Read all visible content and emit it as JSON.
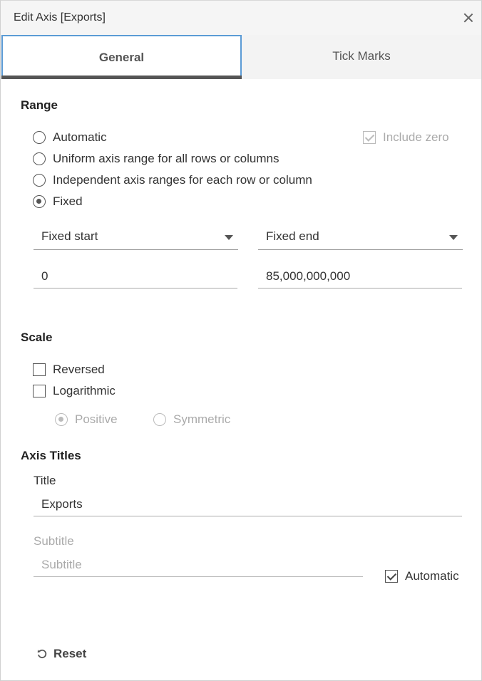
{
  "dialog": {
    "title": "Edit Axis [Exports]"
  },
  "tabs": [
    {
      "label": "General",
      "active": true
    },
    {
      "label": "Tick Marks",
      "active": false
    }
  ],
  "range": {
    "heading": "Range",
    "options": [
      {
        "label": "Automatic",
        "selected": false
      },
      {
        "label": "Uniform axis range for all rows or columns",
        "selected": false
      },
      {
        "label": "Independent axis ranges for each row or column",
        "selected": false
      },
      {
        "label": "Fixed",
        "selected": true
      }
    ],
    "include_zero": {
      "label": "Include zero",
      "checked": true,
      "disabled": true
    },
    "start_dropdown": {
      "value": "Fixed start"
    },
    "end_dropdown": {
      "value": "Fixed end"
    },
    "start_value": "0",
    "end_value": "85,000,000,000"
  },
  "scale": {
    "heading": "Scale",
    "reversed": {
      "label": "Reversed",
      "checked": false
    },
    "logarithmic": {
      "label": "Logarithmic",
      "checked": false
    },
    "log_options": [
      {
        "label": "Positive",
        "selected": true,
        "disabled": true
      },
      {
        "label": "Symmetric",
        "selected": false,
        "disabled": true
      }
    ]
  },
  "axis_titles": {
    "heading": "Axis Titles",
    "title_label": "Title",
    "title_value": "Exports",
    "subtitle_label": "Subtitle",
    "subtitle_placeholder": "Subtitle",
    "automatic": {
      "label": "Automatic",
      "checked": true
    }
  },
  "footer": {
    "reset_label": "Reset"
  },
  "colors": {
    "accent": "#5b9bd5",
    "text": "#333333",
    "disabled": "#aaaaaa"
  },
  "icons": {
    "close": "close-icon",
    "reset": "reset-icon",
    "dropdown": "chevron-down-icon"
  }
}
